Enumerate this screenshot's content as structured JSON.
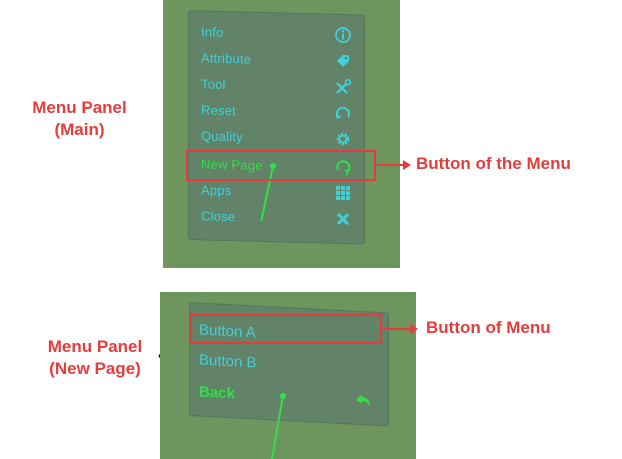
{
  "main_panel": {
    "label_line1": "Menu Panel",
    "label_line2": "(Main)",
    "items": [
      {
        "label": "Info",
        "icon": "info-icon"
      },
      {
        "label": "Attribute",
        "icon": "tag-icon"
      },
      {
        "label": "Tool",
        "icon": "tools-icon"
      },
      {
        "label": "Reset",
        "icon": "reset-icon"
      },
      {
        "label": "Quality",
        "icon": "gear-icon"
      },
      {
        "label": "New Page",
        "icon": "refresh-icon"
      },
      {
        "label": "Apps",
        "icon": "grid-icon"
      },
      {
        "label": "Close",
        "icon": "close-icon"
      }
    ],
    "annotation": "Button of the Menu"
  },
  "new_page_panel": {
    "label_line1": "Menu Panel",
    "label_line2": "(New Page)",
    "items": [
      {
        "label": "Button A"
      },
      {
        "label": "Button B"
      },
      {
        "label": "Back",
        "icon": "back-arrow-icon"
      }
    ],
    "annotation": "Button of Menu"
  },
  "colors": {
    "scene_bg": "#6e955e",
    "cyan_text": "#3fd0d9",
    "green_text": "#2fe047",
    "annotation_red": "#e53c3c"
  }
}
